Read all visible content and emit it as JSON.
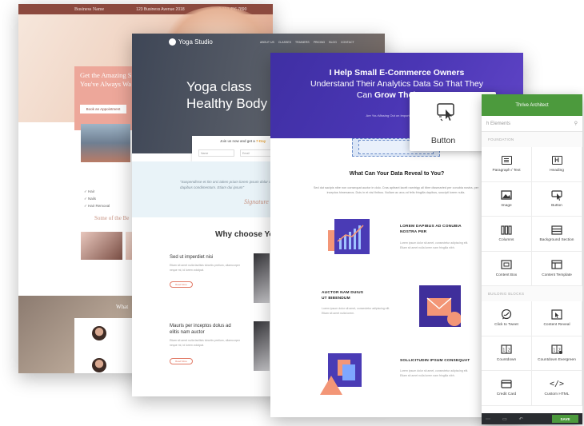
{
  "page1": {
    "business_name": "Business Name",
    "topbar_address": "123 Business Avenue 2018",
    "topbar_phone": "+1 123 456 7890",
    "hero_heading": [
      "Get the Amazing S",
      "You've Always Wa"
    ],
    "hero_button": "Book an Appointment",
    "list_items": [
      "Hair",
      "Nails",
      "Hair Removal"
    ],
    "script_heading": "Some of the Be",
    "bottom_heading": "What"
  },
  "page2": {
    "logo": "Yoga Studio",
    "nav": [
      "ABOUT US",
      "CLASSES",
      "TRAINERS",
      "PRICING",
      "BLOG",
      "CONTACT"
    ],
    "title_line1": "Yoga class",
    "title_line2": "Healthy Body",
    "join_text": "Join us now and get a",
    "join_highlight": "7-Day",
    "input_name": "Name",
    "input_email": "Email",
    "quote": "\"Suspendisse et tim orci taken prium lorem ipsum dolor risit aliquot ex felis dapibus condimentum. Etiam dui ipsum\"",
    "signature": "Signature",
    "why_heading": "Why choose Yoga",
    "features": [
      {
        "title": "Sed ut imperdiet nisi",
        "text": "Etiam sit amet nulla facilisis lobortis pretium, ullamcorper neque mi, id lorem volutpat.",
        "button": "Read More"
      },
      {
        "title": "Mauris per inceptos dolus ad elitis nam auctor",
        "text": "Etiam sit amet nulla facilisis lobortis pretium, ullamcorper neque mi, id lorem volutpat.",
        "button": "Read More"
      }
    ]
  },
  "page3": {
    "headline_line1": "I Help Small E-Commerce Owners",
    "headline_line2": "Understand Their Analytics Data So That They",
    "headline_line3_prefix": "Can",
    "headline_line3_bold": "Grow Their Bus",
    "subline": "Are You Missing Out on Important Insights?",
    "question": "What Can Your Data Reveal to You?",
    "paragraph": "Sed dut sacipis nibe non consequat auctor in dolo. Cras apitrant lacelt narvtrigy all tibre dissmarted per conubia nostra, per inceptos himenaeos. Duis in et nisi finibus. Nullam ac arcu at felis fringilla dapibus, suscipit lorem nulla.",
    "features": [
      {
        "title": [
          "LOREM DAPIBUS AD CONUBIA",
          "NOSTRA PER"
        ],
        "text": "Lorem ipsum dolor sit amet, consectetur adipiscing elit. Etiam sit amet nulla lorem nam fringilla nibh."
      },
      {
        "title": [
          "AUCTOR NAM DUIUS",
          "UT BIBENDUM"
        ],
        "text": "Lorem ipsum dolor sit amet, consectetur adipiscing elit. Etiam sit amet nulla lorem."
      },
      {
        "title": [
          "SOLLICITUDIN IPSUM CONSEQUAT"
        ],
        "text": "Lorem ipsum dolor sit amet, consectetur adipiscing elit. Etiam sit amet nulla lorem nam fringilla nibh."
      }
    ]
  },
  "tooltip": {
    "label": "Button"
  },
  "panel": {
    "title": "Thrive Architect",
    "search_placeholder": "h Elements",
    "section_foundation": "FOUNDATION",
    "foundation": [
      {
        "label": "Paragraph / Text",
        "icon": "paragraph-icon"
      },
      {
        "label": "Heading",
        "icon": "heading-icon"
      },
      {
        "label": "Image",
        "icon": "image-icon"
      },
      {
        "label": "Button",
        "icon": "button-icon"
      },
      {
        "label": "Columns",
        "icon": "columns-icon"
      },
      {
        "label": "Background Section",
        "icon": "background-section-icon"
      },
      {
        "label": "Content Box",
        "icon": "content-box-icon"
      },
      {
        "label": "Content Template",
        "icon": "content-template-icon"
      }
    ],
    "section_blocks": "BUILDING BLOCKS",
    "blocks": [
      {
        "label": "Click to Tweet",
        "icon": "tweet-icon"
      },
      {
        "label": "Content Reveal",
        "icon": "content-reveal-icon"
      },
      {
        "label": "Countdown",
        "icon": "countdown-icon"
      },
      {
        "label": "Countdown Evergreen",
        "icon": "countdown-evergreen-icon"
      },
      {
        "label": "Credit Card",
        "icon": "credit-card-icon"
      },
      {
        "label": "Custom HTML",
        "icon": "custom-html-icon"
      }
    ],
    "save_label": "SAVE",
    "accent": "#4c9a3d"
  }
}
